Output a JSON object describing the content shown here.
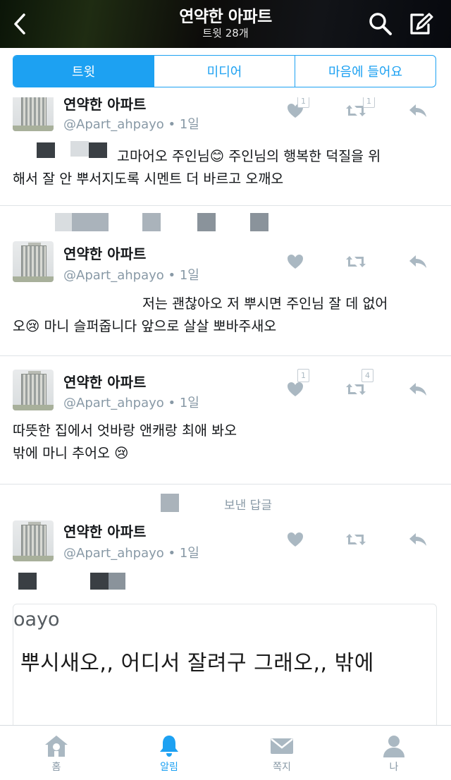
{
  "header": {
    "title": "연약한 아파트",
    "subtitle": "트윗 28개"
  },
  "tabs": [
    {
      "label": "트윗",
      "active": true
    },
    {
      "label": "미디어",
      "active": false
    },
    {
      "label": "마음에 들어요",
      "active": false
    }
  ],
  "tweets": [
    {
      "name": "연약한 아파트",
      "handle": "@Apart_ahpayo • 1일",
      "text_line1": "고마어오 주인님😊 주인님의 행복한 덕질을 위",
      "text_line2": "해서 잘 안 뿌서지도록 시멘트 더 바르고 오깨오",
      "like_count": "1",
      "retweet_count": "1"
    },
    {
      "name": "연약한 아파트",
      "handle": "@Apart_ahpayo • 1일",
      "text_line1": "저는 괜찮아오 저 뿌시면 주인님 잘 데 없어",
      "text_line2": "오😢 마니 슬퍼줍니다 앞으로 살살 뽀바주새오"
    },
    {
      "name": "연약한 아파트",
      "handle": "@Apart_ahpayo • 1일",
      "text_line1": "따뜻한 집에서 엇바랑 앤캐랑 최애 봐오",
      "text_line2": "밖에 마니 추어오 😢",
      "like_count": "1",
      "retweet_count": "4"
    },
    {
      "name": "연약한 아파트",
      "handle": "@Apart_ahpayo • 1일",
      "reply_label": "보낸 답글",
      "quote_handle": "oayo",
      "quote_text": "뿌시새오,, 어디서 잘려구 그래오,, 밖에"
    }
  ],
  "bottom_nav": [
    {
      "label": "홈",
      "icon": "home-icon",
      "active": false
    },
    {
      "label": "알림",
      "icon": "bell-icon",
      "active": true
    },
    {
      "label": "쪽지",
      "icon": "envelope-icon",
      "active": false
    },
    {
      "label": "나",
      "icon": "person-icon",
      "active": false
    }
  ],
  "colors": {
    "accent": "#1da1f2",
    "icon_gray": "#aab8c2",
    "secondary_text": "#8899a6"
  }
}
